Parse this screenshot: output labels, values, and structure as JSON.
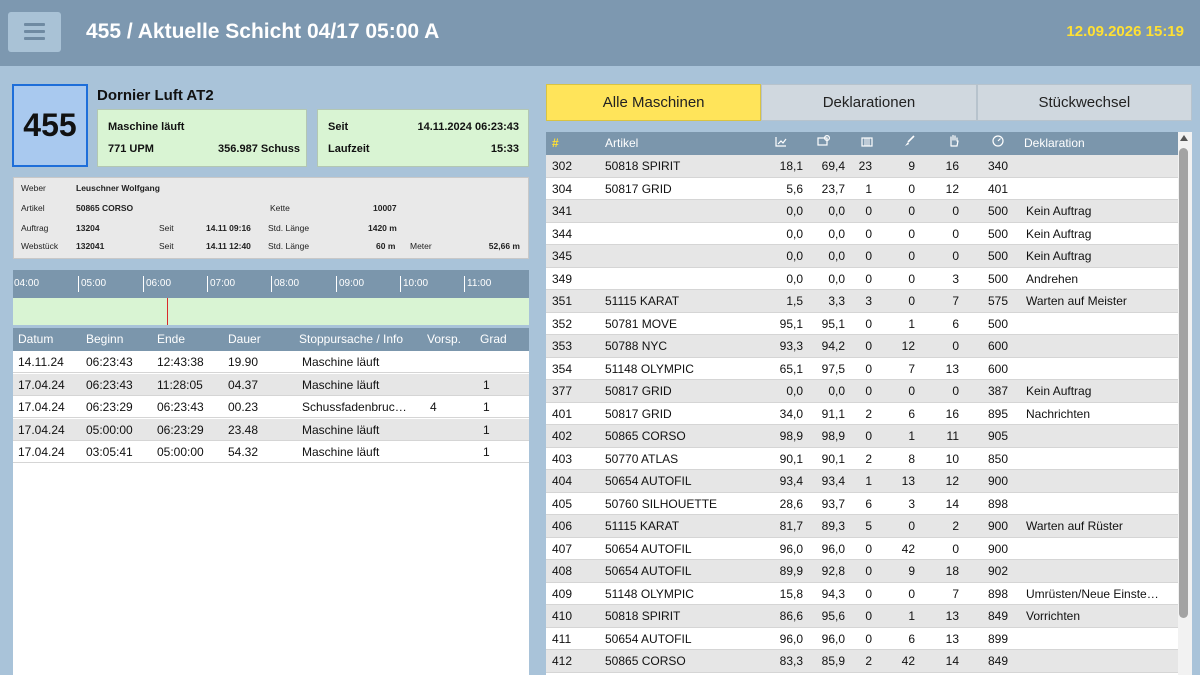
{
  "header": {
    "title": "455 / Aktuelle Schicht 04/17 05:00 A",
    "datetime": "12.09.2026 15:19",
    "menu_icon": "hamburger-icon"
  },
  "machine": {
    "number": "455",
    "name": "Dornier Luft AT2",
    "status": "Maschine läuft",
    "upm": "771 UPM",
    "shots": "356.987 Schuss",
    "since_label": "Seit",
    "since_value": "14.11.2024 06:23:43",
    "runtime_label": "Laufzeit",
    "runtime_value": "15:33"
  },
  "info": {
    "weber_label": "Weber",
    "weber_value": "Leuschner Wolfgang",
    "artikel_label": "Artikel",
    "artikel_value": "50865 CORSO",
    "kette_label": "Kette",
    "kette_value": "10007",
    "auftrag_label": "Auftrag",
    "auftrag_value": "13204",
    "seit1_label": "Seit",
    "seit1_value": "14.11 09:16",
    "stdlaenge1_label": "Std. Länge",
    "stdlaenge1_value": "1420 m",
    "webstueck_label": "Webstück",
    "webstueck_value": "132041",
    "seit2_label": "Seit",
    "seit2_value": "14.11 12:40",
    "stdlaenge2_label": "Std. Länge",
    "stdlaenge2_value": "60 m",
    "meter_label": "Meter",
    "meter_value": "52,66 m"
  },
  "timeline": {
    "ticks": [
      "04:00",
      "05:00",
      "06:00",
      "07:00",
      "08:00",
      "09:00",
      "10:00",
      "11:00"
    ]
  },
  "stops": {
    "headers": [
      "Datum",
      "Beginn",
      "Ende",
      "Dauer",
      "Stoppursache / Info",
      "Vorsp.",
      "Grad"
    ],
    "rows": [
      [
        "14.11.24",
        "06:23:43",
        "12:43:38",
        "19.90",
        "Maschine läuft",
        "",
        ""
      ],
      [
        "17.04.24",
        "06:23:43",
        "11:28:05",
        "04.37",
        "Maschine läuft",
        "",
        "1"
      ],
      [
        "17.04.24",
        "06:23:29",
        "06:23:43",
        "00.23",
        "Schussfadenbruc…",
        "4",
        "1"
      ],
      [
        "17.04.24",
        "05:00:00",
        "06:23:29",
        "23.48",
        "Maschine läuft",
        "",
        "1"
      ],
      [
        "17.04.24",
        "03:05:41",
        "05:00:00",
        "54.32",
        "Maschine läuft",
        "",
        "1"
      ]
    ]
  },
  "tabs": [
    "Alle Maschinen",
    "Deklarationen",
    "Stückwechsel"
  ],
  "machines": {
    "headers": {
      "hash": "#",
      "artikel": "Artikel",
      "deklaration": "Deklaration"
    },
    "header_icons": [
      "chart-icon",
      "efficiency-icon",
      "loom-icon",
      "brush-icon",
      "hand-icon",
      "gauge-icon"
    ],
    "rows": [
      [
        "302",
        "50818 SPIRIT",
        "18,1",
        "69,4",
        "23",
        "9",
        "16",
        "340",
        ""
      ],
      [
        "304",
        "50817 GRID",
        "5,6",
        "23,7",
        "1",
        "0",
        "12",
        "401",
        ""
      ],
      [
        "341",
        "",
        "0,0",
        "0,0",
        "0",
        "0",
        "0",
        "500",
        "Kein Auftrag"
      ],
      [
        "344",
        "",
        "0,0",
        "0,0",
        "0",
        "0",
        "0",
        "500",
        "Kein Auftrag"
      ],
      [
        "345",
        "",
        "0,0",
        "0,0",
        "0",
        "0",
        "0",
        "500",
        "Kein Auftrag"
      ],
      [
        "349",
        "",
        "0,0",
        "0,0",
        "0",
        "0",
        "3",
        "500",
        "Andrehen"
      ],
      [
        "351",
        "51115 KARAT",
        "1,5",
        "3,3",
        "3",
        "0",
        "7",
        "575",
        "Warten auf Meister"
      ],
      [
        "352",
        "50781 MOVE",
        "95,1",
        "95,1",
        "0",
        "1",
        "6",
        "500",
        ""
      ],
      [
        "353",
        "50788 NYC",
        "93,3",
        "94,2",
        "0",
        "12",
        "0",
        "600",
        ""
      ],
      [
        "354",
        "51148 OLYMPIC",
        "65,1",
        "97,5",
        "0",
        "7",
        "13",
        "600",
        ""
      ],
      [
        "377",
        "50817 GRID",
        "0,0",
        "0,0",
        "0",
        "0",
        "0",
        "387",
        "Kein Auftrag"
      ],
      [
        "401",
        "50817 GRID",
        "34,0",
        "91,1",
        "2",
        "6",
        "16",
        "895",
        "Nachrichten"
      ],
      [
        "402",
        "50865 CORSO",
        "98,9",
        "98,9",
        "0",
        "1",
        "11",
        "905",
        ""
      ],
      [
        "403",
        "50770 ATLAS",
        "90,1",
        "90,1",
        "2",
        "8",
        "10",
        "850",
        ""
      ],
      [
        "404",
        "50654 AUTOFIL",
        "93,4",
        "93,4",
        "1",
        "13",
        "12",
        "900",
        ""
      ],
      [
        "405",
        "50760 SILHOUETTE",
        "28,6",
        "93,7",
        "6",
        "3",
        "14",
        "898",
        ""
      ],
      [
        "406",
        "51115 KARAT",
        "81,7",
        "89,3",
        "5",
        "0",
        "2",
        "900",
        "Warten auf Rüster"
      ],
      [
        "407",
        "50654 AUTOFIL",
        "96,0",
        "96,0",
        "0",
        "42",
        "0",
        "900",
        ""
      ],
      [
        "408",
        "50654 AUTOFIL",
        "89,9",
        "92,8",
        "0",
        "9",
        "18",
        "902",
        ""
      ],
      [
        "409",
        "51148 OLYMPIC",
        "15,8",
        "94,3",
        "0",
        "0",
        "7",
        "898",
        "Umrüsten/Neue Einste…"
      ],
      [
        "410",
        "50818 SPIRIT",
        "86,6",
        "95,6",
        "0",
        "1",
        "13",
        "849",
        "Vorrichten"
      ],
      [
        "411",
        "50654 AUTOFIL",
        "96,0",
        "96,0",
        "0",
        "6",
        "13",
        "899",
        ""
      ],
      [
        "412",
        "50865 CORSO",
        "83,3",
        "85,9",
        "2",
        "42",
        "14",
        "849",
        ""
      ]
    ]
  },
  "colors": {
    "header_bg": "#7d98b0",
    "accent_yellow": "#ffe45a",
    "running_green": "#d9f4d3",
    "machine_blue": "#a9c9ef"
  }
}
